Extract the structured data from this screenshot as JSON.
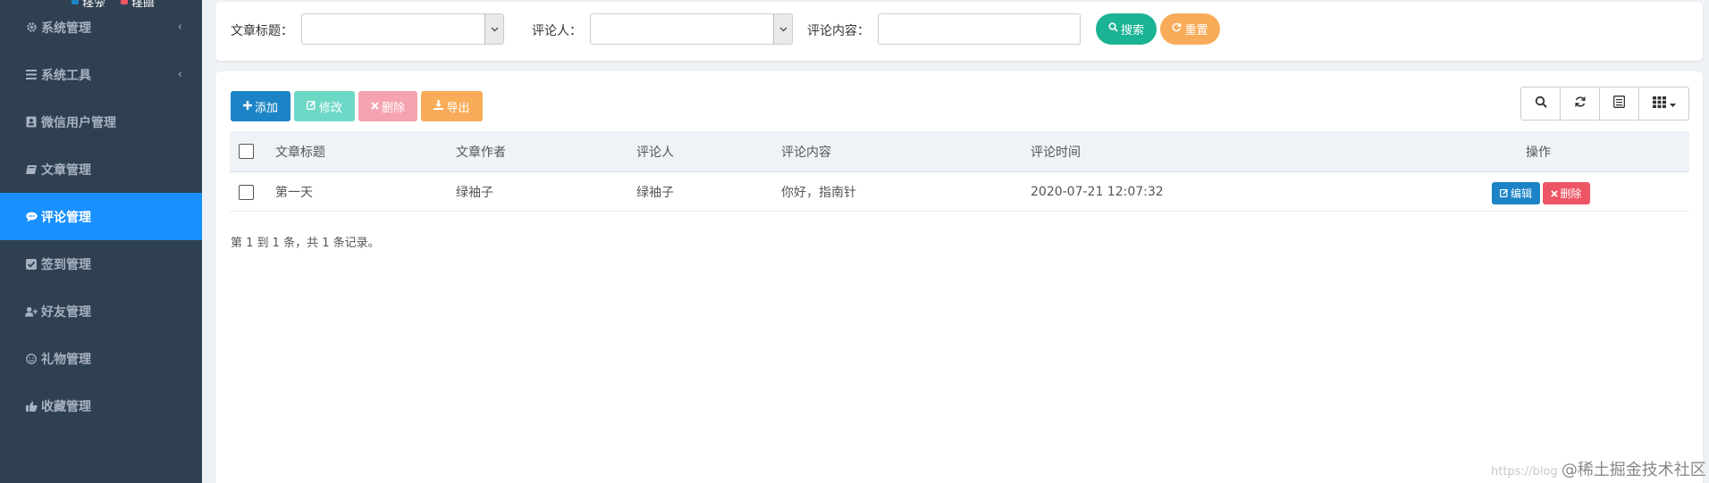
{
  "sidebar": {
    "top_fragments": [
      "择宠",
      "择暗"
    ],
    "items": [
      {
        "label": "系统管理",
        "icon": "gear-icon",
        "has_submenu": true
      },
      {
        "label": "系统工具",
        "icon": "bars-icon",
        "has_submenu": true
      },
      {
        "label": "微信用户管理",
        "icon": "user-card-icon",
        "has_submenu": false
      },
      {
        "label": "文章管理",
        "icon": "book-icon",
        "has_submenu": false
      },
      {
        "label": "评论管理",
        "icon": "comment-icon",
        "has_submenu": false,
        "active": true
      },
      {
        "label": "签到管理",
        "icon": "check-square-icon",
        "has_submenu": false
      },
      {
        "label": "好友管理",
        "icon": "user-plus-icon",
        "has_submenu": false
      },
      {
        "label": "礼物管理",
        "icon": "smile-icon",
        "has_submenu": false
      },
      {
        "label": "收藏管理",
        "icon": "thumbs-up-icon",
        "has_submenu": false
      }
    ],
    "chevron": "‹"
  },
  "search": {
    "title_label": "文章标题：",
    "title_value": "",
    "commenter_label": "评论人：",
    "commenter_value": "",
    "content_label": "评论内容：",
    "content_value": "",
    "search_btn": "搜索",
    "reset_btn": "重置"
  },
  "toolbar": {
    "add": "添加",
    "edit": "修改",
    "delete": "删除",
    "export": "导出"
  },
  "table": {
    "headers": [
      "文章标题",
      "文章作者",
      "评论人",
      "评论内容",
      "评论时间",
      "操作"
    ],
    "rows": [
      {
        "title": "第一天",
        "author": "绿袖子",
        "commenter": "绿袖子",
        "content": "你好，指南针",
        "time": "2020-07-21 12:07:32",
        "edit": "编辑",
        "delete": "删除"
      }
    ],
    "summary": "第 1 到 1 条，共 1 条记录。"
  },
  "watermark": {
    "url": "https://blog",
    "brand": "@稀土掘金技术社区"
  },
  "colors": {
    "sidebar_bg": "#2f4050",
    "active": "#1890ff",
    "primary": "#1c84c6",
    "success": "#1ab394",
    "edit_light": "#6ed8c7",
    "danger_light": "#f5a3b0",
    "danger": "#ed5565",
    "warning": "#f8ac59"
  }
}
